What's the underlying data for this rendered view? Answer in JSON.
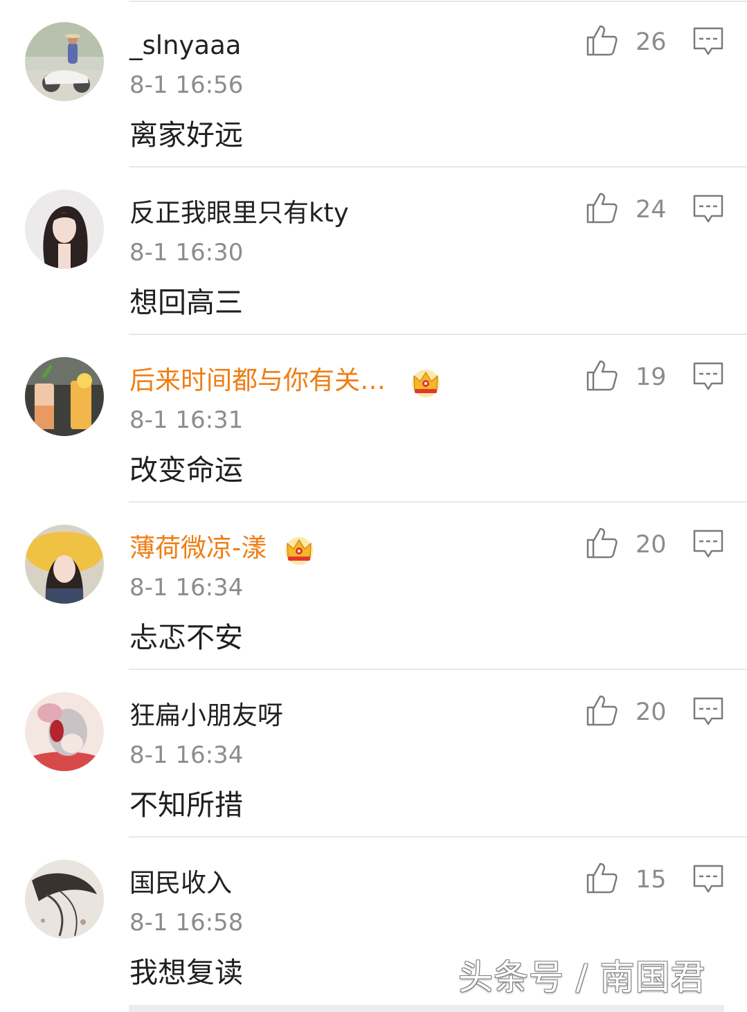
{
  "comments": [
    {
      "username": "_slnyaaa",
      "vip": false,
      "time": "8-1 16:56",
      "text": "离家好远",
      "likes": "26",
      "avatar_icon": "avatar-girl-on-scooter-photo"
    },
    {
      "username": "反正我眼里只有kty",
      "vip": false,
      "time": "8-1 16:30",
      "text": "想回高三",
      "likes": "24",
      "avatar_icon": "avatar-long-hair-girl-photo"
    },
    {
      "username": "后来时间都与你有关…",
      "vip": true,
      "time": "8-1 16:31",
      "text": "改变命运",
      "likes": "19",
      "avatar_icon": "avatar-drinks-photo"
    },
    {
      "username": "薄荷微凉-漾",
      "vip": true,
      "time": "8-1 16:34",
      "text": "忐忑不安",
      "likes": "20",
      "avatar_icon": "avatar-yellow-hat-girl-photo"
    },
    {
      "username": "狂扁小朋友呀",
      "vip": false,
      "time": "8-1 16:34",
      "text": "不知所措",
      "likes": "20",
      "avatar_icon": "avatar-cartoon-mouse-photo"
    },
    {
      "username": "国民收入",
      "vip": false,
      "time": "8-1 16:58",
      "text": "我想复读",
      "likes": "15",
      "avatar_icon": "avatar-dark-hair-photo"
    }
  ],
  "icons": {
    "like": "thumbs-up-icon",
    "reply": "comment-bubble-icon",
    "vip": "crown-icon"
  },
  "colors": {
    "vip_name": "#ef7e14",
    "text": "#1f1f1f",
    "meta": "#8c8c8c",
    "divider": "#e7e7e7"
  },
  "watermark": "头条号 / 南国君"
}
